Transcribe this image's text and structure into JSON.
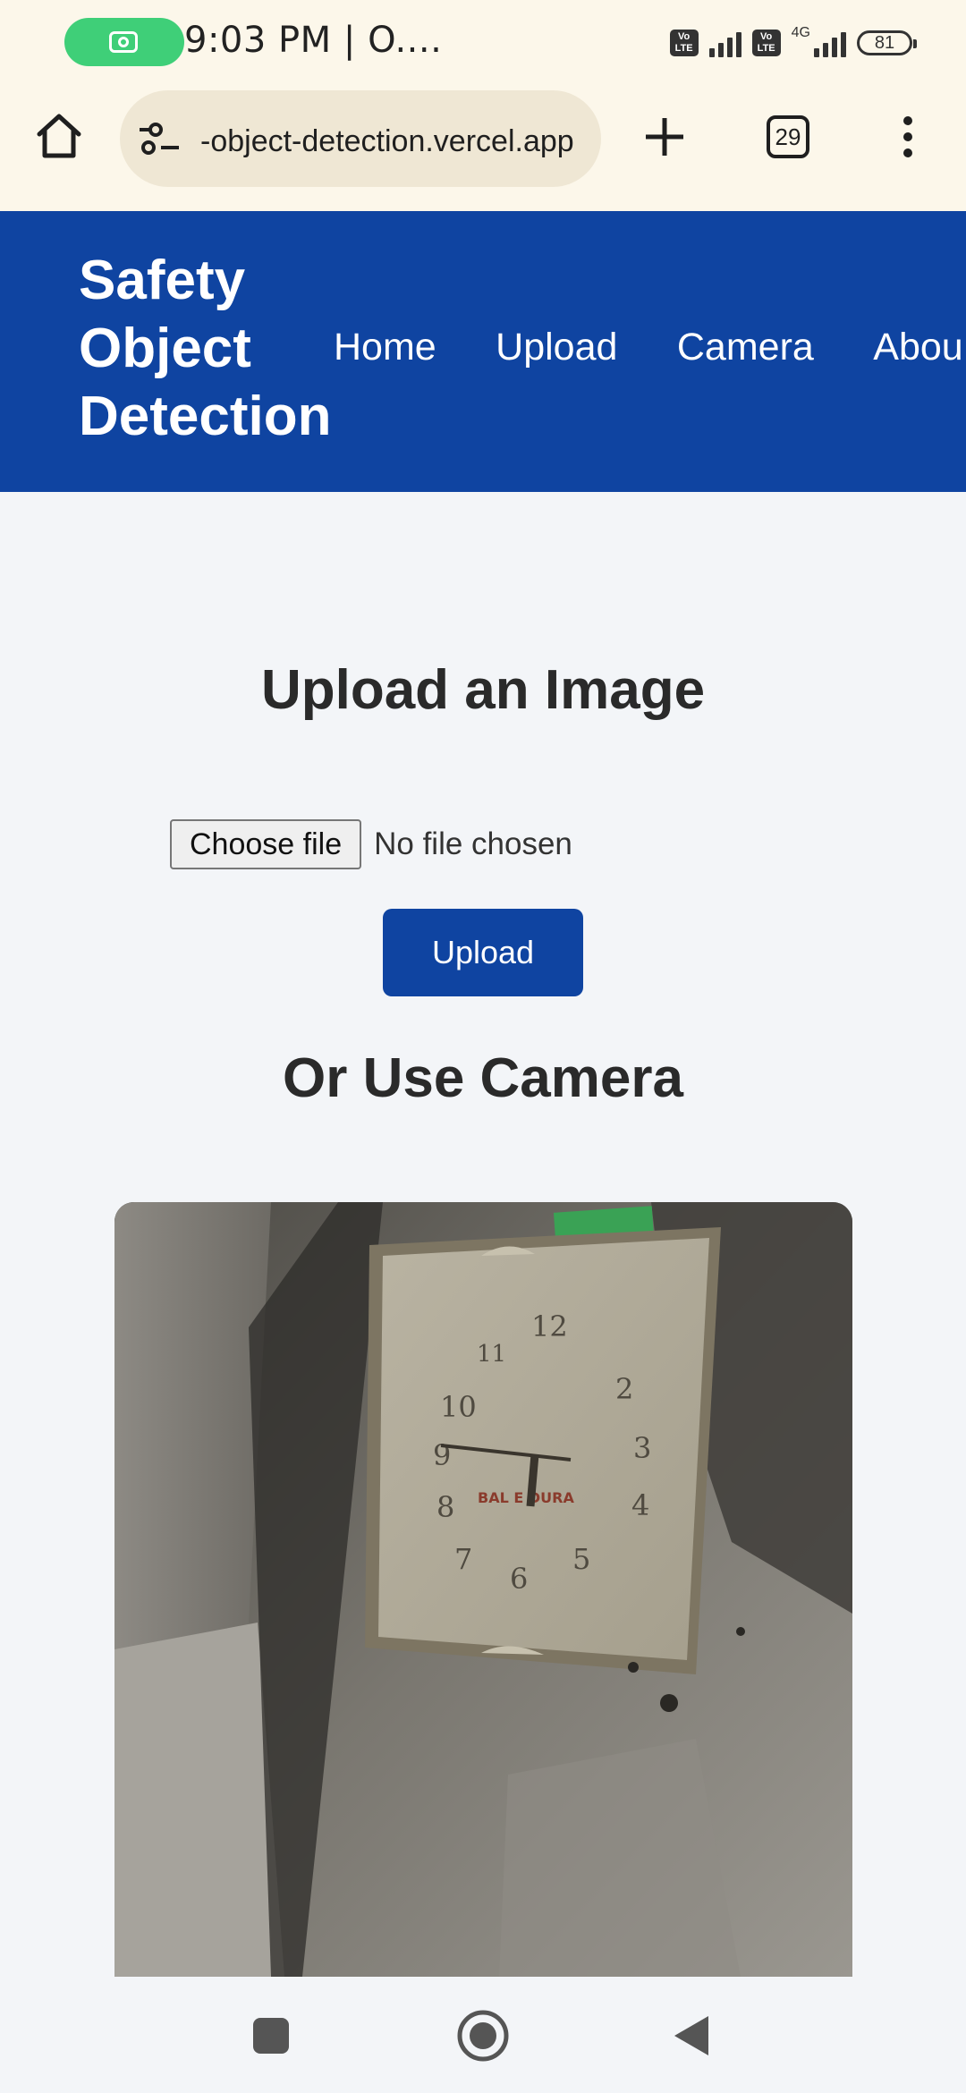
{
  "status_bar": {
    "time_text": "9:03 PM | O....",
    "volte_label": "Vo\nLTE",
    "network_label": "4G",
    "battery_level": "81"
  },
  "browser": {
    "url_text": "-object-detection.vercel.app",
    "tab_count": "29",
    "icons": [
      "home-icon",
      "site-settings-icon",
      "new-tab-icon",
      "tab-switcher-icon",
      "more-menu-icon"
    ]
  },
  "site_header": {
    "brand": "Safety Object Detection",
    "nav": [
      "Home",
      "Upload",
      "Camera",
      "Abou"
    ]
  },
  "main": {
    "upload_heading": "Upload an Image",
    "choose_file_label": "Choose file",
    "no_file_text": "No file chosen",
    "upload_button": "Upload",
    "camera_heading": "Or Use Camera",
    "clock_dial_text": "BAL E DURA",
    "clock_numbers": [
      "12",
      "2",
      "3",
      "4",
      "5",
      "6",
      "7",
      "8",
      "9",
      "10",
      "11"
    ]
  },
  "colors": {
    "brand_blue": "#0f44a1",
    "status_bg": "#fcf7ea",
    "page_bg": "#f3f5f8",
    "camera_pill": "#3fcf78"
  }
}
